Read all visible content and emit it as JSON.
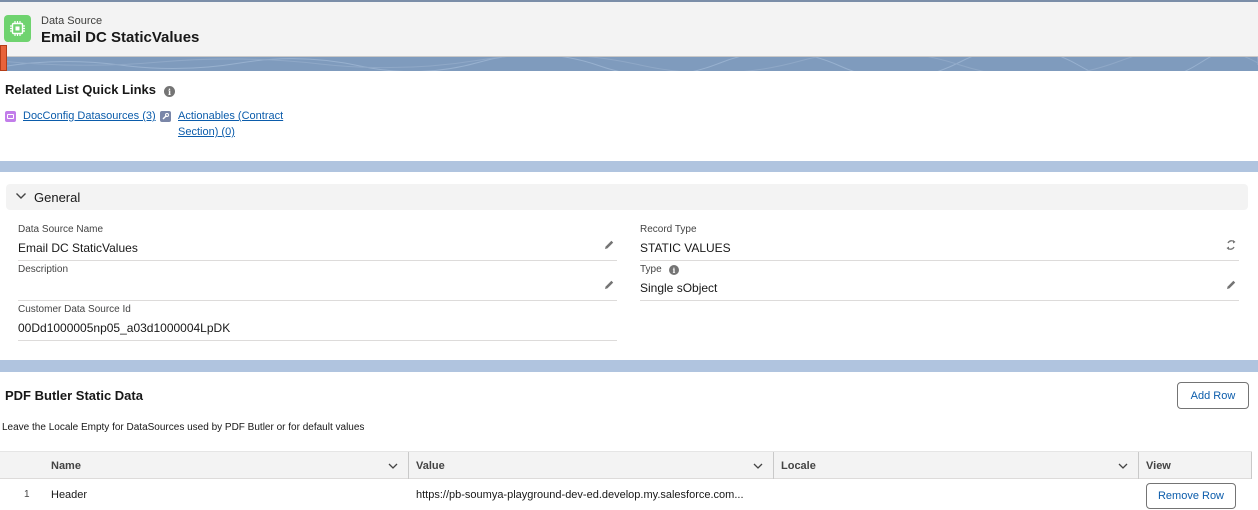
{
  "header": {
    "eyebrow": "Data Source",
    "title": "Email DC StaticValues",
    "icon": "chip-icon",
    "icon_color": "#6fd36f"
  },
  "quick_links": {
    "title": "Related List Quick Links",
    "links": [
      {
        "label": "DocConfig Datasources (3)",
        "icon_color": "#c27dea"
      },
      {
        "label_line1": "Actionables (Contract",
        "label_line2": "Section) (0)",
        "icon_color": "#7a86a8"
      }
    ]
  },
  "general": {
    "section_label": "General",
    "fields": {
      "data_source_name": {
        "label": "Data Source Name",
        "value": "Email DC StaticValues"
      },
      "description": {
        "label": "Description",
        "value": ""
      },
      "customer_data_source_id": {
        "label": "Customer Data Source Id",
        "value": "00Dd1000005np05_a03d1000004LpDK"
      },
      "record_type": {
        "label": "Record Type",
        "value": "STATIC VALUES"
      },
      "type": {
        "label": "Type",
        "value": "Single sObject"
      }
    }
  },
  "static_data": {
    "title": "PDF Butler Static Data",
    "add_row_label": "Add Row",
    "note": "Leave the Locale Empty for DataSources used by PDF Butler or for default values",
    "columns": [
      "Name",
      "Value",
      "Locale",
      "View"
    ],
    "rows": [
      {
        "index": "1",
        "name": "Header",
        "value": "https://pb-soumya-playground-dev-ed.develop.my.salesforce.com...",
        "locale": "",
        "action_label": "Remove Row"
      }
    ]
  },
  "colors": {
    "link": "#0b5cab",
    "band": "#b0c4df",
    "accent_tab": "#e8633a"
  }
}
